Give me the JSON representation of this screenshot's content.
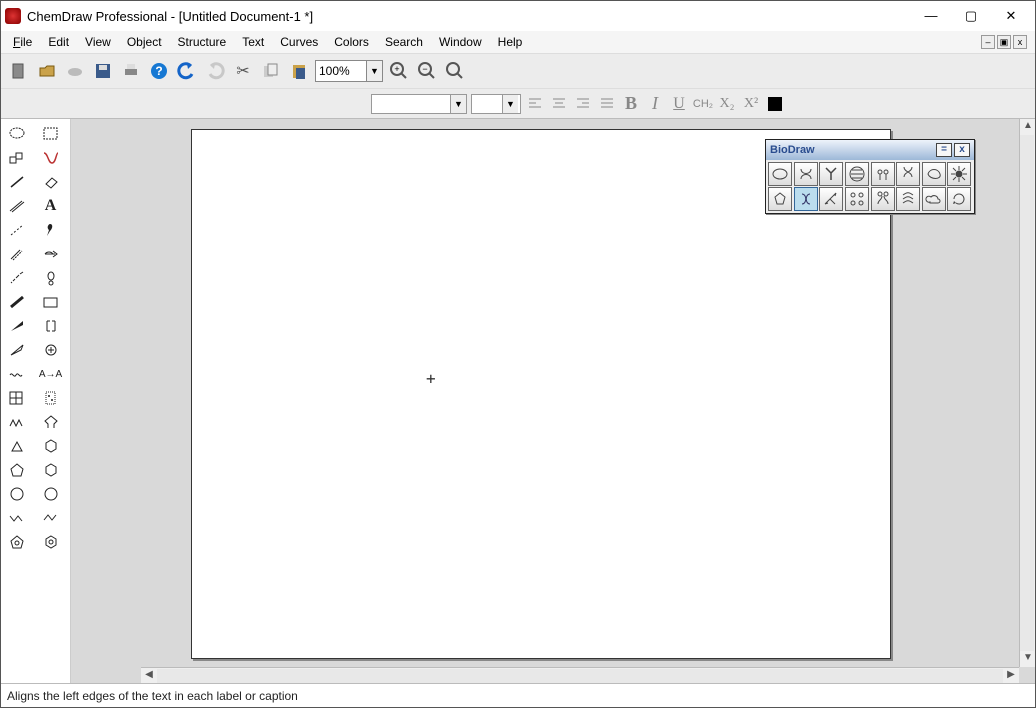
{
  "title": "ChemDraw Professional - [Untitled Document-1 *]",
  "menu": [
    "File",
    "Edit",
    "View",
    "Object",
    "Structure",
    "Text",
    "Curves",
    "Colors",
    "Search",
    "Window",
    "Help"
  ],
  "zoom_value": "100%",
  "formatting": {
    "bold": "B",
    "italic": "I",
    "underline": "U",
    "ch2": "CH₂",
    "x2": "X₂",
    "x_sup": "X²"
  },
  "biodraw": {
    "title": "BioDraw"
  },
  "status": "Aligns the left edges of the text in each label or caption"
}
